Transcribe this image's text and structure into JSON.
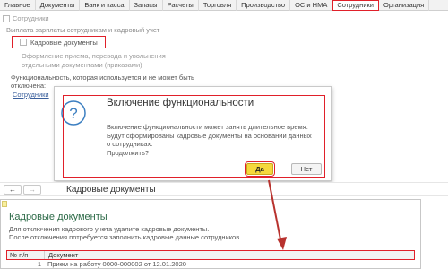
{
  "tabs": [
    {
      "label": "Главное",
      "active": false
    },
    {
      "label": "Документы",
      "active": false
    },
    {
      "label": "Банк и касса",
      "active": false
    },
    {
      "label": "Запасы",
      "active": false
    },
    {
      "label": "Расчеты",
      "active": false
    },
    {
      "label": "Торговля",
      "active": false
    },
    {
      "label": "Производство",
      "active": false
    },
    {
      "label": "ОС и НМА",
      "active": false
    },
    {
      "label": "Сотрудники",
      "active": true
    },
    {
      "label": "Организация",
      "active": false
    }
  ],
  "settings": {
    "employees_checkbox_label": "Сотрудники",
    "section_hint": "Выплата зарплаты сотрудникам и кадровый учет",
    "hr_docs_checkbox_label": "Кадровые документы",
    "hr_docs_checked": false,
    "hr_docs_description": "Оформление приема, перевода и увольнения отдельными документами (приказами)",
    "functionality_note": "Функциональность, которая используется и не может быть отключена:",
    "functionality_link": "Сотрудники"
  },
  "dialog": {
    "title": "Включение функциональности",
    "message": "Включение функциональности может занять длительное время. Будут сформированы кадровые документы на основании данных о сотрудниках.",
    "question": "Продолжить?",
    "icon": "question-icon",
    "yes_label": "Да",
    "no_label": "Нет"
  },
  "nav": {
    "back_icon": "←",
    "forward_icon": "→",
    "title": "Кадровые документы"
  },
  "panel": {
    "title": "Кадровые документы",
    "text_line1": "Для отключения кадрового учета удалите кадровые документы.",
    "text_line2": "После отключения потребуется заполнить кадровые данные сотрудников.",
    "table": {
      "headers": [
        "№ п/п",
        "Документ"
      ],
      "rows": [
        {
          "num": "1",
          "doc": "Прием на работу 0000-000002 от 12.01.2020"
        }
      ]
    }
  },
  "colors": {
    "highlight": "#e0202a",
    "accent_yes": "#f5d83c",
    "link": "#3a5f9c",
    "panel_title": "#2d6b48"
  }
}
